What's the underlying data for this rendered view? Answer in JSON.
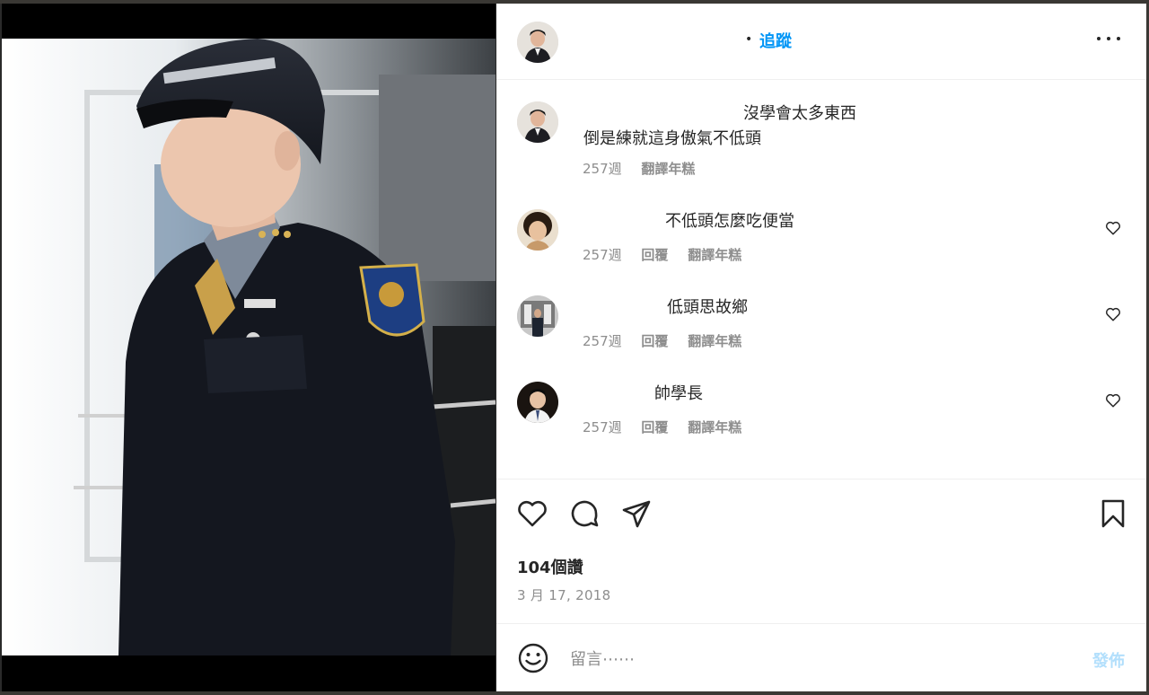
{
  "header": {
    "follow_label": "追蹤",
    "separator": "•",
    "avatar_icon": "user-avatar-icon",
    "more_icon": "more-options-icon"
  },
  "comments": [
    {
      "line1": "沒學會太多東西",
      "line2": "倒是練就這身傲氣不低頭",
      "time": "257週",
      "actions": [
        "翻譯年糕"
      ],
      "has_like": false
    },
    {
      "line1": "不低頭怎麼吃便當",
      "time": "257週",
      "actions": [
        "回覆",
        "翻譯年糕"
      ],
      "has_like": true
    },
    {
      "line1": "低頭思故鄉",
      "time": "257週",
      "actions": [
        "回覆",
        "翻譯年糕"
      ],
      "has_like": true
    },
    {
      "line1": "帥學長",
      "time": "257週",
      "actions": [
        "回覆",
        "翻譯年糕"
      ],
      "has_like": true
    }
  ],
  "actions": {
    "icons": [
      "heart-icon",
      "comment-icon",
      "share-icon",
      "bookmark-icon"
    ],
    "likes": "104個讚",
    "date": "3 月 17, 2018"
  },
  "comment_box": {
    "placeholder": "留言⋯⋯",
    "post_label": "發佈",
    "emoji_icon": "emoji-icon"
  },
  "colors": {
    "accent": "#0095f6",
    "post_disabled": "#b2dffc",
    "muted": "#8e8e8e",
    "text": "#262626"
  }
}
